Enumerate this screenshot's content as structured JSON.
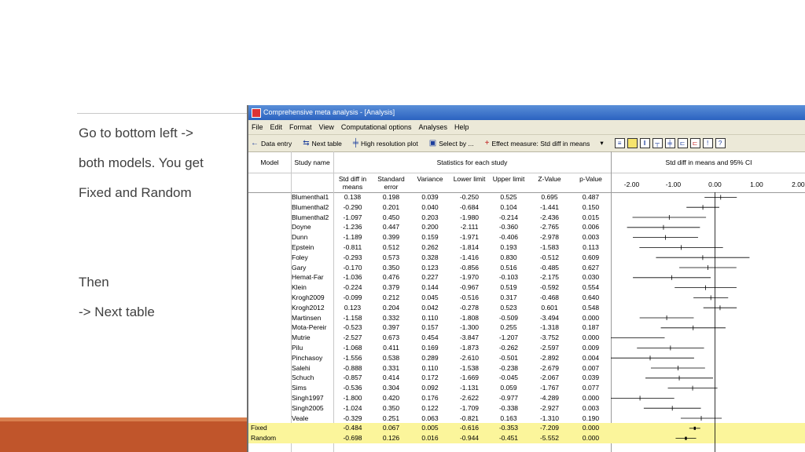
{
  "slide": {
    "notes": [
      "Go to bottom left ->",
      "both models.  You get",
      "Fixed and Random",
      "Then",
      "-> Next table"
    ]
  },
  "window": {
    "title": "Comprehensive meta analysis - [Analysis]",
    "menu": [
      "File",
      "Edit",
      "Format",
      "View",
      "Computational options",
      "Analyses",
      "Help"
    ],
    "toolbar": {
      "data_entry": "Data entry",
      "next_table": "Next table",
      "high_res": "High resolution plot",
      "select_by": "Select by ...",
      "effect_measure": "Effect measure: Std diff in means"
    }
  },
  "table": {
    "group_headers": {
      "model": "Model",
      "study": "Study name",
      "stats": "Statistics for each study",
      "plot": "Std diff in means and 95% CI"
    },
    "columns": [
      "Std diff in means",
      "Standard error",
      "Variance",
      "Lower limit",
      "Upper limit",
      "Z-Value",
      "p-Value"
    ],
    "axis_ticks": [
      "-2.00",
      "-1.00",
      "0.00",
      "1.00",
      "2.00"
    ],
    "rows": [
      {
        "model": "",
        "study": "Blumenthal1",
        "vals": [
          "0.138",
          "0.198",
          "0.039",
          "-0.250",
          "0.525",
          "0.695",
          "0.487"
        ]
      },
      {
        "model": "",
        "study": "Blumenthal2",
        "vals": [
          "-0.290",
          "0.201",
          "0.040",
          "-0.684",
          "0.104",
          "-1.441",
          "0.150"
        ]
      },
      {
        "model": "",
        "study": "Blumenthal2",
        "vals": [
          "-1.097",
          "0.450",
          "0.203",
          "-1.980",
          "-0.214",
          "-2.436",
          "0.015"
        ]
      },
      {
        "model": "",
        "study": "Doyne",
        "vals": [
          "-1.236",
          "0.447",
          "0.200",
          "-2.111",
          "-0.360",
          "-2.765",
          "0.006"
        ]
      },
      {
        "model": "",
        "study": "Dunn",
        "vals": [
          "-1.189",
          "0.399",
          "0.159",
          "-1.971",
          "-0.406",
          "-2.978",
          "0.003"
        ]
      },
      {
        "model": "",
        "study": "Epstein",
        "vals": [
          "-0.811",
          "0.512",
          "0.262",
          "-1.814",
          "0.193",
          "-1.583",
          "0.113"
        ]
      },
      {
        "model": "",
        "study": "Foley",
        "vals": [
          "-0.293",
          "0.573",
          "0.328",
          "-1.416",
          "0.830",
          "-0.512",
          "0.609"
        ]
      },
      {
        "model": "",
        "study": "Gary",
        "vals": [
          "-0.170",
          "0.350",
          "0.123",
          "-0.856",
          "0.516",
          "-0.485",
          "0.627"
        ]
      },
      {
        "model": "",
        "study": "Hemat-Far",
        "vals": [
          "-1.036",
          "0.476",
          "0.227",
          "-1.970",
          "-0.103",
          "-2.175",
          "0.030"
        ]
      },
      {
        "model": "",
        "study": "Klein",
        "vals": [
          "-0.224",
          "0.379",
          "0.144",
          "-0.967",
          "0.519",
          "-0.592",
          "0.554"
        ]
      },
      {
        "model": "",
        "study": "Krogh2009",
        "vals": [
          "-0.099",
          "0.212",
          "0.045",
          "-0.516",
          "0.317",
          "-0.468",
          "0.640"
        ]
      },
      {
        "model": "",
        "study": "Krogh2012",
        "vals": [
          "0.123",
          "0.204",
          "0.042",
          "-0.278",
          "0.523",
          "0.601",
          "0.548"
        ]
      },
      {
        "model": "",
        "study": "Martinsen",
        "vals": [
          "-1.158",
          "0.332",
          "0.110",
          "-1.808",
          "-0.509",
          "-3.494",
          "0.000"
        ]
      },
      {
        "model": "",
        "study": "Mota-Pereir",
        "vals": [
          "-0.523",
          "0.397",
          "0.157",
          "-1.300",
          "0.255",
          "-1.318",
          "0.187"
        ]
      },
      {
        "model": "",
        "study": "Mutrie",
        "vals": [
          "-2.527",
          "0.673",
          "0.454",
          "-3.847",
          "-1.207",
          "-3.752",
          "0.000"
        ]
      },
      {
        "model": "",
        "study": "Pilu",
        "vals": [
          "-1.068",
          "0.411",
          "0.169",
          "-1.873",
          "-0.262",
          "-2.597",
          "0.009"
        ]
      },
      {
        "model": "",
        "study": "Pinchasoy",
        "vals": [
          "-1.556",
          "0.538",
          "0.289",
          "-2.610",
          "-0.501",
          "-2.892",
          "0.004"
        ]
      },
      {
        "model": "",
        "study": "Salehi",
        "vals": [
          "-0.888",
          "0.331",
          "0.110",
          "-1.538",
          "-0.238",
          "-2.679",
          "0.007"
        ]
      },
      {
        "model": "",
        "study": "Schuch",
        "vals": [
          "-0.857",
          "0.414",
          "0.172",
          "-1.669",
          "-0.045",
          "-2.067",
          "0.039"
        ]
      },
      {
        "model": "",
        "study": "Sims",
        "vals": [
          "-0.536",
          "0.304",
          "0.092",
          "-1.131",
          "0.059",
          "-1.767",
          "0.077"
        ]
      },
      {
        "model": "",
        "study": "Singh1997",
        "vals": [
          "-1.800",
          "0.420",
          "0.176",
          "-2.622",
          "-0.977",
          "-4.289",
          "0.000"
        ]
      },
      {
        "model": "",
        "study": "Singh2005",
        "vals": [
          "-1.024",
          "0.350",
          "0.122",
          "-1.709",
          "-0.338",
          "-2.927",
          "0.003"
        ]
      },
      {
        "model": "",
        "study": "Veale",
        "vals": [
          "-0.329",
          "0.251",
          "0.063",
          "-0.821",
          "0.163",
          "-1.310",
          "0.190"
        ]
      },
      {
        "model": "Fixed",
        "study": "",
        "vals": [
          "-0.484",
          "0.067",
          "0.005",
          "-0.616",
          "-0.353",
          "-7.209",
          "0.000"
        ]
      },
      {
        "model": "Random",
        "study": "",
        "vals": [
          "-0.698",
          "0.126",
          "0.016",
          "-0.944",
          "-0.451",
          "-5.552",
          "0.000"
        ]
      }
    ]
  },
  "colors": {
    "highlight": "#fbf59b",
    "accent": "#c0552b",
    "titlebar": "#2b62c0"
  },
  "icons": [
    "arrow-left-icon",
    "next-table-icon",
    "plot-icon",
    "select-icon",
    "effect-measure-icon"
  ]
}
